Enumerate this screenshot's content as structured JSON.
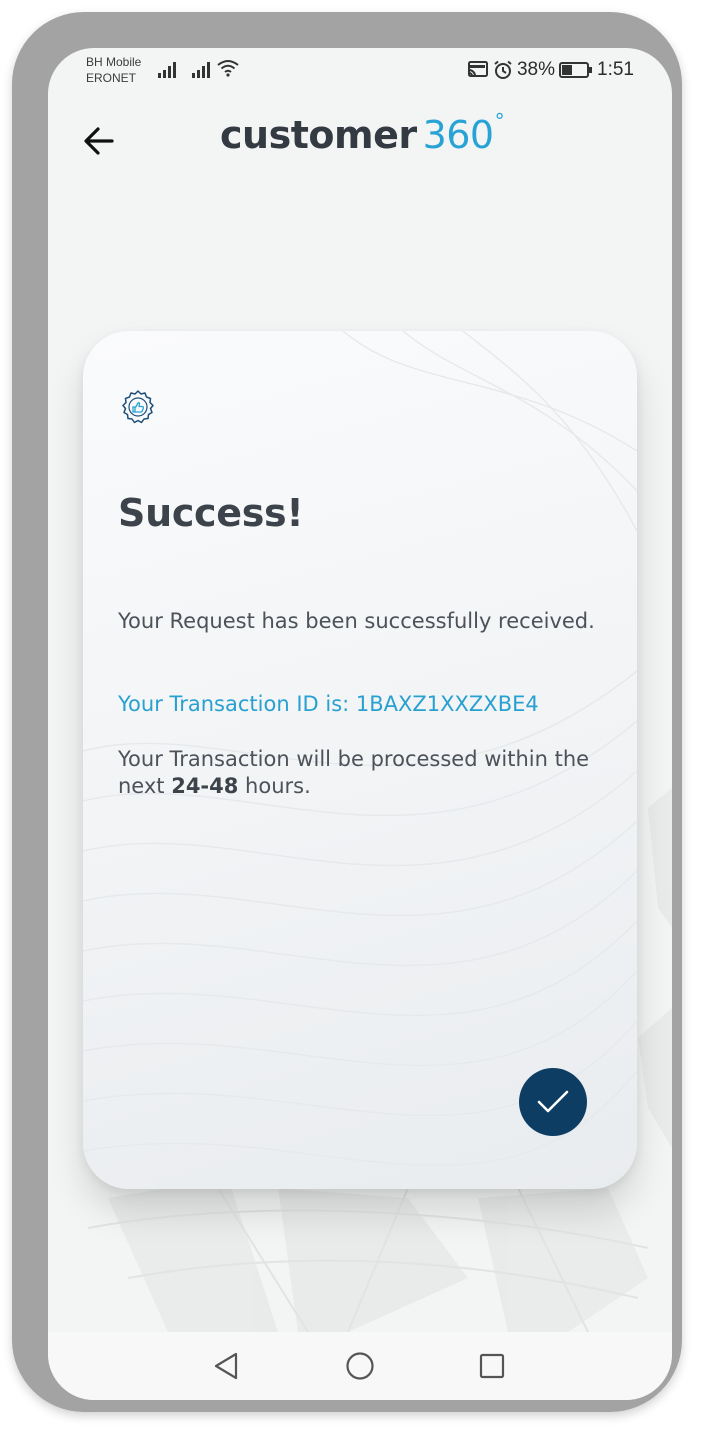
{
  "status_bar": {
    "carrier_line1": "BH Mobile",
    "carrier_line2": "ERONET",
    "battery": "38%",
    "time": "1:51",
    "icons": [
      "signal-icon",
      "signal-icon",
      "wifi-icon",
      "cast-icon",
      "alarm-icon",
      "battery-icon"
    ]
  },
  "header": {
    "back_icon": "arrow-left-icon",
    "logo_word": "customer",
    "logo_number": "360",
    "logo_degree": "°"
  },
  "card": {
    "badge_icon": "thumbs-up-badge-icon",
    "title": "Success!",
    "received_text": "Your Request has been successfully received.",
    "transaction_id_text": "Your Transaction ID is: 1BAXZ1XXZXBE4",
    "processing_text_before": "Your Transaction will be processed within the next ",
    "processing_hours": "24-48",
    "processing_text_after": " hours.",
    "confirm_icon": "checkmark-icon"
  },
  "nav_bar": {
    "icons": [
      "back-triangle-icon",
      "home-circle-icon",
      "recents-square-icon"
    ]
  },
  "colors": {
    "accent_blue": "#28a3d6",
    "confirm_button": "#0d3d63",
    "title_text": "#3c434b",
    "frame": "#a3a3a3"
  }
}
